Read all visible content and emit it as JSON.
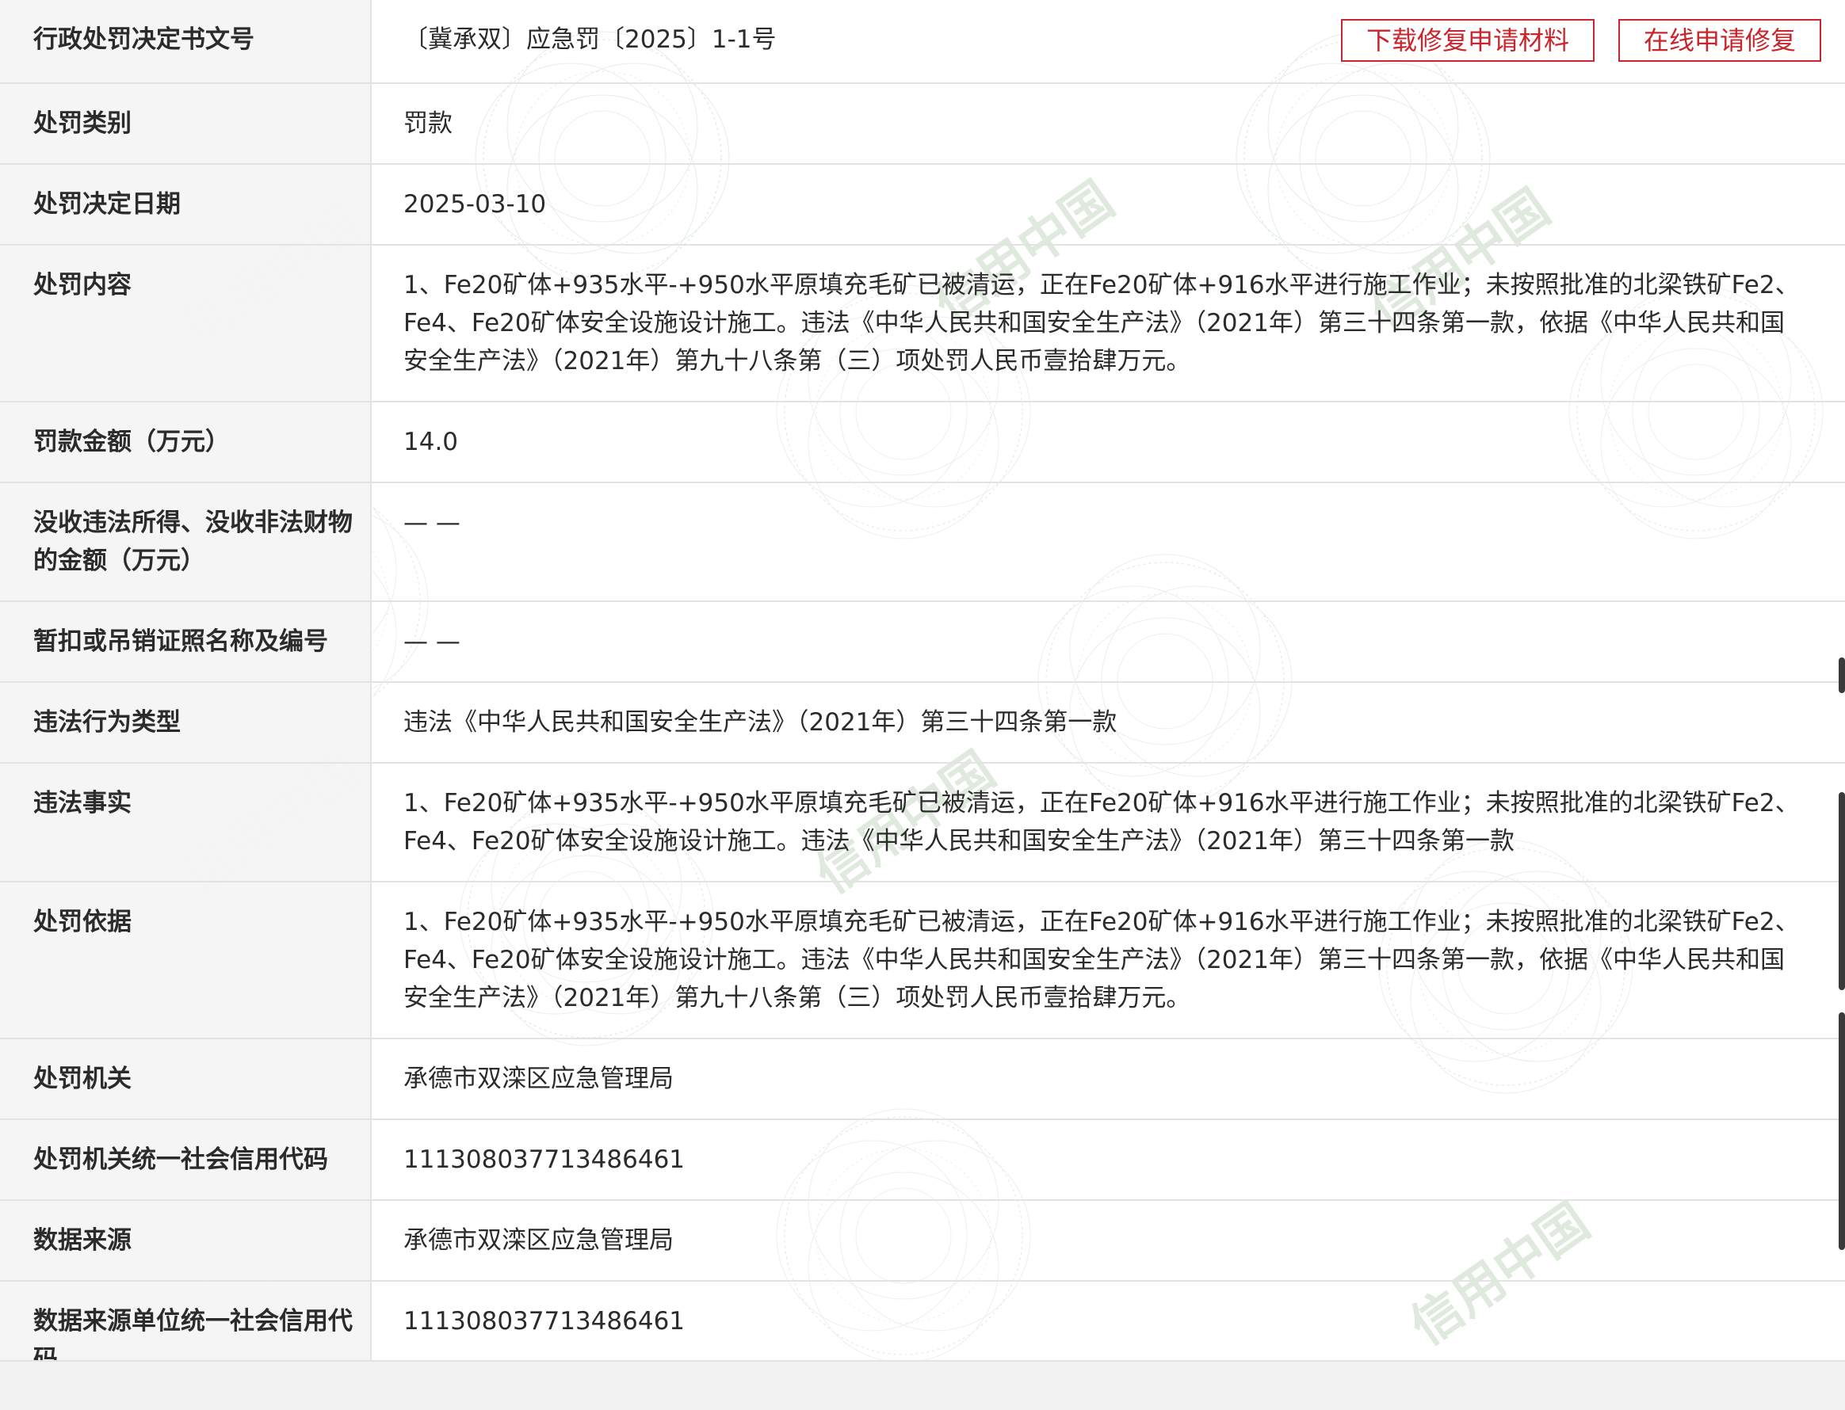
{
  "buttons": {
    "download": "下载修复申请材料",
    "apply_online": "在线申请修复"
  },
  "watermark": {
    "text": "信用中国"
  },
  "rows": [
    {
      "label": "行政处罚决定书文号",
      "value": "〔冀承双〕应急罚〔2025〕1-1号"
    },
    {
      "label": "处罚类别",
      "value": "罚款"
    },
    {
      "label": "处罚决定日期",
      "value": "2025-03-10"
    },
    {
      "label": "处罚内容",
      "value": "1、Fe20矿体+935水平-+950水平原填充毛矿已被清运，正在Fe20矿体+916水平进行施工作业；未按照批准的北梁铁矿Fe2、Fe4、Fe20矿体安全设施设计施工。违法《中华人民共和国安全生产法》（2021年）第三十四条第一款，依据《中华人民共和国安全生产法》（2021年）第九十八条第（三）项处罚人民币壹拾肆万元。"
    },
    {
      "label": "罚款金额（万元）",
      "value": "14.0"
    },
    {
      "label": "没收违法所得、没收非法财物的金额（万元）",
      "value": "— —"
    },
    {
      "label": "暂扣或吊销证照名称及编号",
      "value": "— —"
    },
    {
      "label": "违法行为类型",
      "value": "违法《中华人民共和国安全生产法》（2021年）第三十四条第一款"
    },
    {
      "label": "违法事实",
      "value": "1、Fe20矿体+935水平-+950水平原填充毛矿已被清运，正在Fe20矿体+916水平进行施工作业；未按照批准的北梁铁矿Fe2、Fe4、Fe20矿体安全设施设计施工。违法《中华人民共和国安全生产法》（2021年）第三十四条第一款"
    },
    {
      "label": "处罚依据",
      "value": "1、Fe20矿体+935水平-+950水平原填充毛矿已被清运，正在Fe20矿体+916水平进行施工作业；未按照批准的北梁铁矿Fe2、Fe4、Fe20矿体安全设施设计施工。违法《中华人民共和国安全生产法》（2021年）第三十四条第一款，依据《中华人民共和国安全生产法》（2021年）第九十八条第（三）项处罚人民币壹拾肆万元。"
    },
    {
      "label": "处罚机关",
      "value": "承德市双滦区应急管理局"
    },
    {
      "label": "处罚机关统一社会信用代码",
      "value": "111308037713486461"
    },
    {
      "label": "数据来源",
      "value": "承德市双滦区应急管理局"
    },
    {
      "label": "数据来源单位统一社会信用代码",
      "value": "111308037713486461"
    }
  ],
  "colors": {
    "accent_red": "#c8252c",
    "label_bg": "#f4f4f4",
    "border": "#e3e3e3"
  }
}
